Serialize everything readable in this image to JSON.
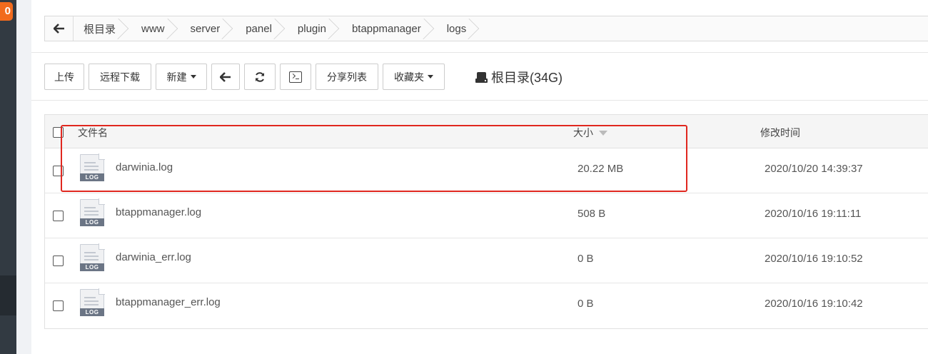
{
  "sidebar": {
    "badge": "0"
  },
  "breadcrumb": {
    "back_icon": "arrow-left-icon",
    "items": [
      "根目录",
      "www",
      "server",
      "panel",
      "plugin",
      "btappmanager",
      "logs"
    ]
  },
  "toolbar": {
    "upload": "上传",
    "remote_download": "远程下载",
    "new": "新建",
    "back_icon": "arrow-left-icon",
    "refresh_icon": "refresh-icon",
    "terminal_icon": "terminal-icon",
    "share_list": "分享列表",
    "favorites": "收藏夹",
    "disk_label": "根目录(34G)"
  },
  "table": {
    "headers": {
      "name": "文件名",
      "size": "大小",
      "modified": "修改时间"
    },
    "rows": [
      {
        "name": "darwinia.log",
        "size": "20.22 MB",
        "modified": "2020/10/20 14:39:37",
        "type": "LOG"
      },
      {
        "name": "btappmanager.log",
        "size": "508 B",
        "modified": "2020/10/16 19:11:11",
        "type": "LOG"
      },
      {
        "name": "darwinia_err.log",
        "size": "0 B",
        "modified": "2020/10/16 19:10:52",
        "type": "LOG"
      },
      {
        "name": "btappmanager_err.log",
        "size": "0 B",
        "modified": "2020/10/16 19:10:42",
        "type": "LOG"
      }
    ]
  },
  "colors": {
    "highlight": "#e0271f",
    "badge": "#f26b1d",
    "sidebar": "#323a42"
  }
}
